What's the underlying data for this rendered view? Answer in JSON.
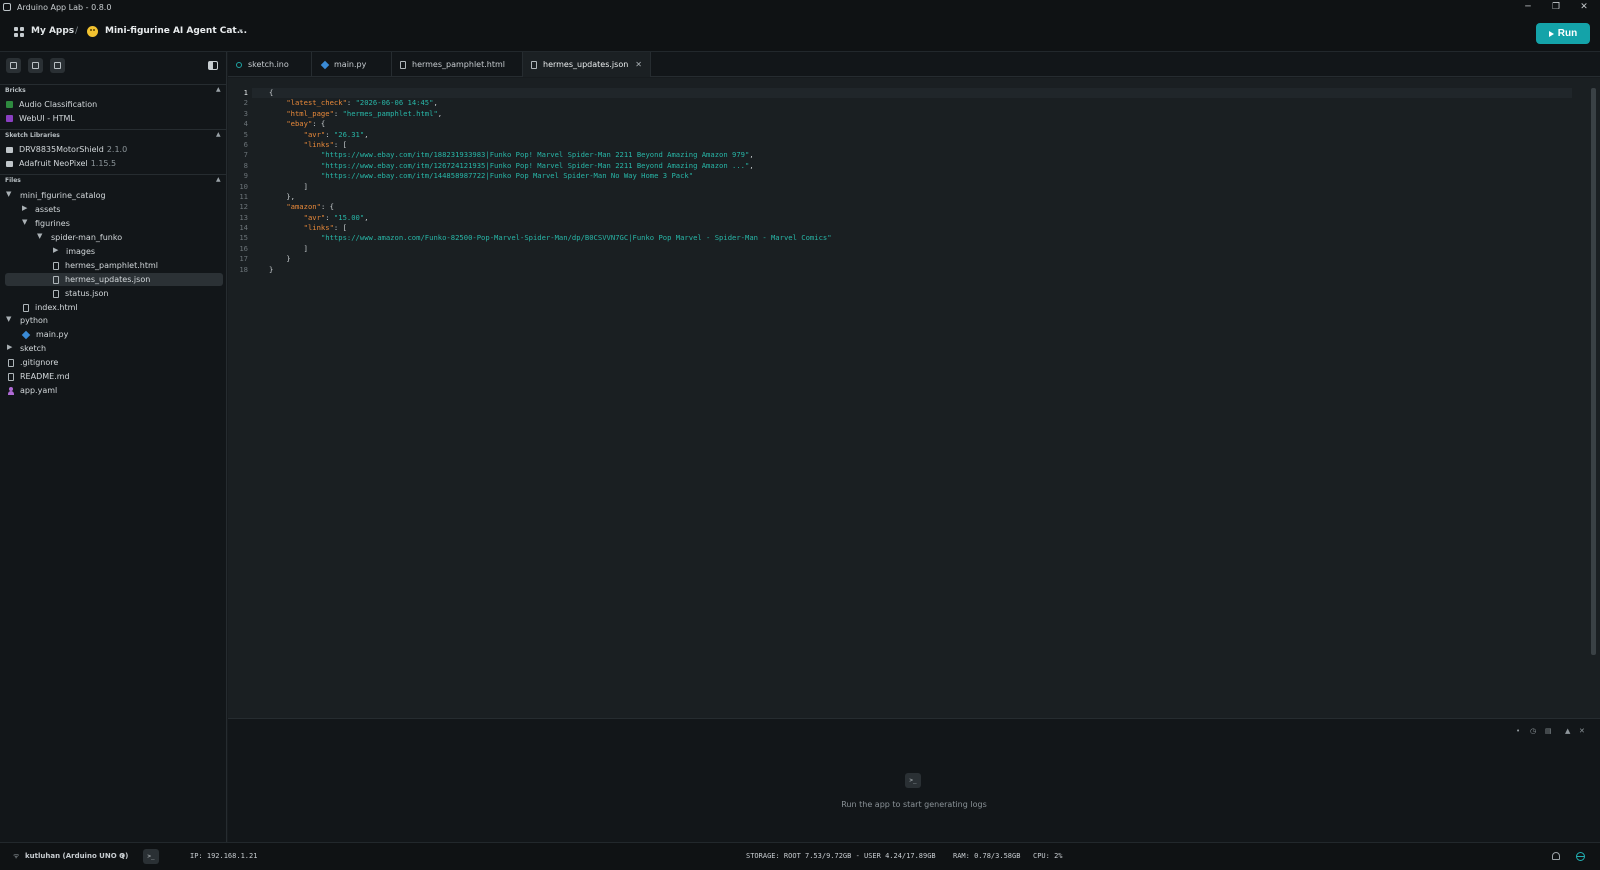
{
  "window": {
    "title": "Arduino App Lab - 0.8.0",
    "minimize": "─",
    "restore": "❐",
    "close": "✕"
  },
  "header": {
    "my_apps": "My Apps",
    "separator": "/",
    "app_name": "Mini-figurine AI Agent Cat...",
    "caret": "▾",
    "run_label": "Run",
    "accent_color": "#14a3a9"
  },
  "sidebar": {
    "sections": {
      "bricks": "Bricks",
      "sketch_libraries": "Sketch Libraries",
      "files": "Files"
    },
    "bricks": [
      {
        "label": "Audio Classification",
        "icon": "brick-green-icon"
      },
      {
        "label": "WebUI - HTML",
        "icon": "brick-purple-icon"
      }
    ],
    "libraries": [
      {
        "name": "DRV8835MotorShield",
        "version": "2.1.0"
      },
      {
        "name": "Adafruit NeoPixel",
        "version": "1.15.5"
      }
    ],
    "files": {
      "root": "mini_figurine_catalog",
      "assets": "assets",
      "figurines": "figurines",
      "spider_man_funko": "spider-man_funko",
      "images": "images",
      "hermes_pamphlet": "hermes_pamphlet.html",
      "hermes_updates": "hermes_updates.json",
      "status": "status.json",
      "index": "index.html",
      "python": "python",
      "main_py": "main.py",
      "sketch": "sketch",
      "gitignore": ".gitignore",
      "readme": "README.md",
      "app_yaml": "app.yaml"
    }
  },
  "tabs": [
    {
      "label": "sketch.ino"
    },
    {
      "label": "main.py"
    },
    {
      "label": "hermes_pamphlet.html"
    },
    {
      "label": "hermes_updates.json",
      "active": true
    }
  ],
  "editor": {
    "line_numbers": [
      "1",
      "2",
      "3",
      "4",
      "5",
      "6",
      "7",
      "8",
      "9",
      "10",
      "11",
      "12",
      "13",
      "14",
      "15",
      "16",
      "17",
      "18"
    ],
    "lines": [
      [
        {
          "t": "{",
          "c": "p"
        }
      ],
      [
        {
          "t": "    ",
          "c": "p"
        },
        {
          "t": "\"latest_check\"",
          "c": "k"
        },
        {
          "t": ": ",
          "c": "p"
        },
        {
          "t": "\"2026-06-06 14:45\"",
          "c": "s"
        },
        {
          "t": ",",
          "c": "p"
        }
      ],
      [
        {
          "t": "    ",
          "c": "p"
        },
        {
          "t": "\"html_page\"",
          "c": "k"
        },
        {
          "t": ": ",
          "c": "p"
        },
        {
          "t": "\"hermes_pamphlet.html\"",
          "c": "s"
        },
        {
          "t": ",",
          "c": "p"
        }
      ],
      [
        {
          "t": "    ",
          "c": "p"
        },
        {
          "t": "\"ebay\"",
          "c": "k"
        },
        {
          "t": ": {",
          "c": "p"
        }
      ],
      [
        {
          "t": "        ",
          "c": "p"
        },
        {
          "t": "\"avr\"",
          "c": "k"
        },
        {
          "t": ": ",
          "c": "p"
        },
        {
          "t": "\"26.31\"",
          "c": "s"
        },
        {
          "t": ",",
          "c": "p"
        }
      ],
      [
        {
          "t": "        ",
          "c": "p"
        },
        {
          "t": "\"links\"",
          "c": "k"
        },
        {
          "t": ": [",
          "c": "p"
        }
      ],
      [
        {
          "t": "            ",
          "c": "p"
        },
        {
          "t": "\"https://www.ebay.com/itm/188231933983|Funko Pop! Marvel Spider-Man 2211 Beyond Amazing Amazon 979\"",
          "c": "s"
        },
        {
          "t": ",",
          "c": "p"
        }
      ],
      [
        {
          "t": "            ",
          "c": "p"
        },
        {
          "t": "\"https://www.ebay.com/itm/126724121935|Funko Pop! Marvel Spider-Man 2211 Beyond Amazing Amazon ...\"",
          "c": "s"
        },
        {
          "t": ",",
          "c": "p"
        }
      ],
      [
        {
          "t": "            ",
          "c": "p"
        },
        {
          "t": "\"https://www.ebay.com/itm/144858987722|Funko Pop Marvel Spider-Man No Way Home 3 Pack\"",
          "c": "s"
        }
      ],
      [
        {
          "t": "        ]",
          "c": "p"
        }
      ],
      [
        {
          "t": "    },",
          "c": "p"
        }
      ],
      [
        {
          "t": "    ",
          "c": "p"
        },
        {
          "t": "\"amazon\"",
          "c": "k"
        },
        {
          "t": ": {",
          "c": "p"
        }
      ],
      [
        {
          "t": "        ",
          "c": "p"
        },
        {
          "t": "\"avr\"",
          "c": "k"
        },
        {
          "t": ": ",
          "c": "p"
        },
        {
          "t": "\"15.00\"",
          "c": "s"
        },
        {
          "t": ",",
          "c": "p"
        }
      ],
      [
        {
          "t": "        ",
          "c": "p"
        },
        {
          "t": "\"links\"",
          "c": "k"
        },
        {
          "t": ": [",
          "c": "p"
        }
      ],
      [
        {
          "t": "            ",
          "c": "p"
        },
        {
          "t": "\"https://www.amazon.com/Funko-82500-Pop-Marvel-Spider-Man/dp/B0CSVVN7GC|Funko Pop Marvel - Spider-Man - Marvel Comics\"",
          "c": "s"
        }
      ],
      [
        {
          "t": "        ]",
          "c": "p"
        }
      ],
      [
        {
          "t": "    }",
          "c": "p"
        }
      ],
      [
        {
          "t": "}",
          "c": "p"
        }
      ]
    ]
  },
  "logs": {
    "message": "Run the app to start generating logs",
    "terminal_glyph": ">_"
  },
  "statusbar": {
    "board": "kutluhan (Arduino UNO Q)",
    "caret": "▾",
    "ip": "IP: 192.168.1.21",
    "storage": "STORAGE: ROOT 7.53/9.72GB - USER 4.24/17.89GB",
    "ram": "RAM: 0.78/3.58GB",
    "cpu": "CPU: 2%"
  }
}
